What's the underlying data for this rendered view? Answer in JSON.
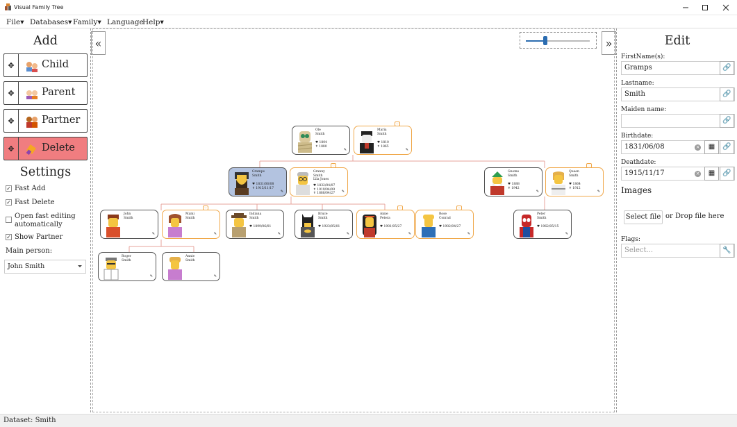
{
  "app": {
    "title": "Visual Family Tree"
  },
  "menu": [
    "File",
    "Databases",
    "Family",
    "Language",
    "Help"
  ],
  "left": {
    "add_header": "Add",
    "buttons": {
      "child": "Child",
      "parent": "Parent",
      "partner": "Partner",
      "delete": "Delete"
    },
    "settings_header": "Settings",
    "fast_add": "Fast Add",
    "fast_delete": "Fast Delete",
    "open_fast_editing": "Open fast editing automatically",
    "show_partner": "Show Partner",
    "main_person_label": "Main person:",
    "main_person_value": "John Smith"
  },
  "right": {
    "edit_header": "Edit",
    "firstname_label": "FirstName(s):",
    "firstname_value": "Gramps",
    "lastname_label": "Lastname:",
    "lastname_value": "Smith",
    "maiden_label": "Maiden name:",
    "maiden_value": "",
    "birthdate_label": "Birthdate:",
    "birthdate_value": "1831/06/08",
    "deathdate_label": "Deathdate:",
    "deathdate_value": "1915/11/17",
    "images_header": "Images",
    "select_file": "Select file",
    "drop_text": "or Drop file here",
    "flags_label": "Flags:",
    "flags_placeholder": "Select..."
  },
  "zoom_level": 0.3,
  "status": {
    "dataset": "Dataset: Smith"
  },
  "tree": {
    "ole": {
      "name": "Ole\nSmith",
      "dates": "♥ 1804\n✝ 1880"
    },
    "maria": {
      "name": "Maria\nSmith",
      "dates": "♥ 1810\n✝ 1865"
    },
    "gramps": {
      "name": "Gramps\nSmith",
      "dates": "♥ 1831/06/08\n✝ 1915/11/17"
    },
    "granny": {
      "name": "Granny\nSmith\nLila Jones",
      "dates": "♥ 1832/04/07\n✝ 1919/04/09\n✝ 1888/04/27"
    },
    "gnome": {
      "name": "Gnome\nSmith",
      "dates": "♥ 1888\n✝ 1942"
    },
    "queen": {
      "name": "Queen\nSmith",
      "dates": "♥ 1864\n✝ 1912"
    },
    "john": {
      "name": "John\nSmith",
      "dates": ""
    },
    "mami": {
      "name": "Mami\nSmith",
      "dates": ""
    },
    "indiana": {
      "name": "Indiana\nSmith",
      "dates": "♥ 1899/06/01"
    },
    "bruce": {
      "name": "Bruce\nSmith",
      "dates": "♥ 1923/05/01"
    },
    "anne": {
      "name": "Anne\nPetera",
      "dates": "♥ 1901/05/27"
    },
    "rose": {
      "name": "Rose\nConrad",
      "dates": "♥ 1902/04/27"
    },
    "peter": {
      "name": "Peter\nSmith",
      "dates": "♥ 1962/05/15"
    },
    "roger": {
      "name": "Roger\nSmith",
      "dates": ""
    },
    "annie": {
      "name": "Annie\nSmith",
      "dates": ""
    }
  }
}
